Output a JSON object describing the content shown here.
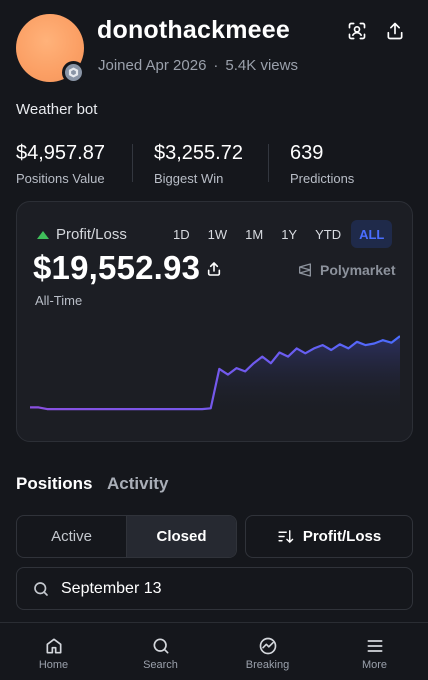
{
  "profile": {
    "username": "donothackmeee",
    "joined": "Joined Apr 2026",
    "views": "5.4K views",
    "bio": "Weather bot",
    "avatar_color": "#fb9f64"
  },
  "header_actions": {
    "scan_icon": "scan-face-icon",
    "share_icon": "share-icon"
  },
  "stats": [
    {
      "value": "$4,957.87",
      "label": "Positions Value"
    },
    {
      "value": "$3,255.72",
      "label": "Biggest Win"
    },
    {
      "value": "639",
      "label": "Predictions"
    }
  ],
  "pl_card": {
    "label": "Profit/Loss",
    "value": "$19,552.93",
    "period": "All-Time",
    "brand": "Polymarket",
    "ranges": [
      "1D",
      "1W",
      "1M",
      "1Y",
      "YTD",
      "ALL"
    ],
    "active_range": "ALL",
    "accent": "#4a6dff",
    "up_color": "#3fbf5a",
    "line_color": "#6b5cf0"
  },
  "chart_data": {
    "type": "line",
    "title": "",
    "xlabel": "",
    "ylabel": "",
    "series": [
      {
        "values": [
          0.08,
          0.08,
          0.06,
          0.06,
          0.06,
          0.06,
          0.06,
          0.06,
          0.06,
          0.06,
          0.06,
          0.06,
          0.06,
          0.06,
          0.06,
          0.06,
          0.06,
          0.06,
          0.06,
          0.06,
          0.06,
          0.07,
          0.55,
          0.48,
          0.56,
          0.52,
          0.62,
          0.7,
          0.62,
          0.75,
          0.7,
          0.8,
          0.74,
          0.8,
          0.84,
          0.78,
          0.85,
          0.8,
          0.88,
          0.84,
          0.86,
          0.9,
          0.87,
          0.95
        ]
      }
    ]
  },
  "tabs": {
    "positions": "Positions",
    "activity": "Activity"
  },
  "filters": {
    "active": "Active",
    "closed": "Closed",
    "sort": "Profit/Loss"
  },
  "search": {
    "value": "September 13",
    "placeholder": "Search"
  },
  "nav": [
    {
      "label": "Home",
      "icon": "home-icon"
    },
    {
      "label": "Search",
      "icon": "search-icon"
    },
    {
      "label": "Breaking",
      "icon": "breaking-icon"
    },
    {
      "label": "More",
      "icon": "menu-icon"
    }
  ]
}
